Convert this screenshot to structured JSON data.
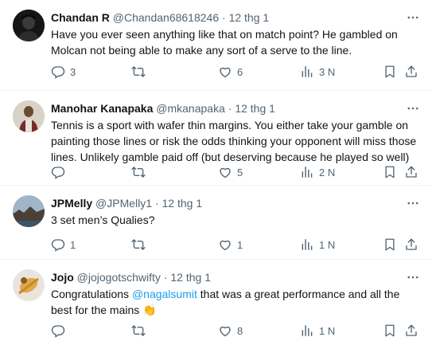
{
  "tweets": [
    {
      "name": "Chandan R",
      "handle": "@Chandan68618246",
      "dot": "·",
      "time": "12 thg 1",
      "text": "Have you ever seen anything like that on match point? He gambled on Molcan not being able to make any sort of a serve to the line.",
      "replies": "3",
      "reposts": "",
      "likes": "6",
      "views": "3 N"
    },
    {
      "name": "Manohar Kanapaka",
      "handle": "@mkanapaka",
      "dot": "·",
      "time": "12 thg 1",
      "text": "Tennis is a sport with wafer thin margins. You either take your gamble on painting those lines or risk the odds thinking your opponent will miss those lines. Unlikely gamble paid off (but deserving because he played so well)",
      "replies": "",
      "reposts": "",
      "likes": "5",
      "views": "2 N"
    },
    {
      "name": "JPMelly",
      "handle": "@JPMelly1",
      "dot": "·",
      "time": "12 thg 1",
      "text": "3 set men’s Qualies?",
      "replies": "1",
      "reposts": "",
      "likes": "1",
      "views": "1 N"
    },
    {
      "name": "Jojo",
      "handle": "@jojogotschwifty",
      "dot": "·",
      "time": "12 thg 1",
      "text_prefix": "Congratulations ",
      "mention": "@nagalsumit",
      "text_suffix": " that was a great performance and all the best for the mains ",
      "emoji": "👏",
      "replies": "",
      "reposts": "",
      "likes": "8",
      "views": "1 N"
    }
  ],
  "icons": {
    "reply": "reply-icon",
    "repost": "repost-icon",
    "like": "heart-icon",
    "views": "views-icon",
    "bookmark": "bookmark-icon",
    "share": "share-icon",
    "more": "more-icon"
  },
  "colors": {
    "text": "#0f1419",
    "secondary": "#536471",
    "mention": "#1d9bf0",
    "divider": "#eff3f4"
  }
}
